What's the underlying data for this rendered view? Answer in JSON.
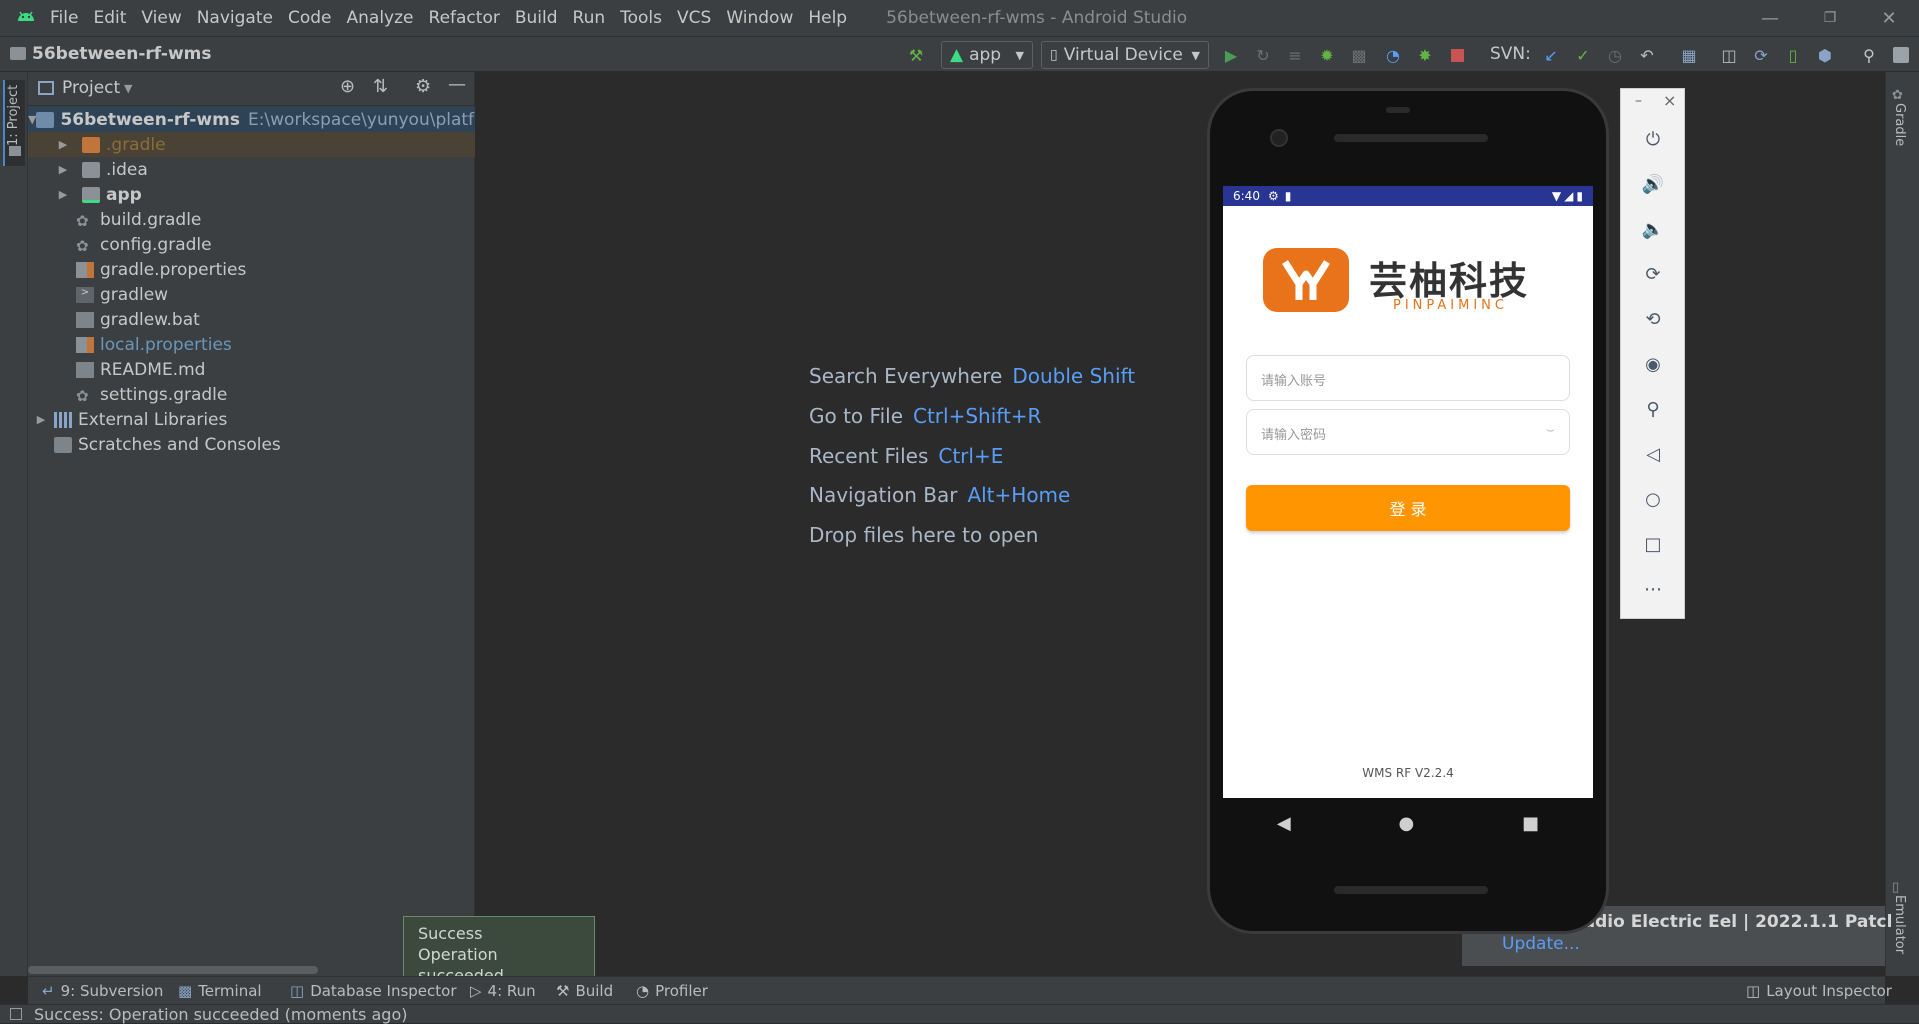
{
  "window": {
    "title": "56between-rf-wms - Android Studio",
    "controls": {
      "minimize": "—",
      "restore": "❐",
      "close": "✕"
    }
  },
  "menu": [
    "File",
    "Edit",
    "View",
    "Navigate",
    "Code",
    "Analyze",
    "Refactor",
    "Build",
    "Run",
    "Tools",
    "VCS",
    "Window",
    "Help"
  ],
  "navbar": {
    "breadcrumb": "56between-rf-wms",
    "run_config": "app",
    "device": "Virtual Device",
    "svn_label": "SVN:"
  },
  "left_stripe": {
    "project_tab": "1: Project"
  },
  "right_stripe": {
    "gradle_tab": "Gradle",
    "emulator_tab": "Emulator"
  },
  "project_panel": {
    "header": "Project",
    "tree": [
      {
        "name": "56between-rf-wms",
        "path": "E:\\workspace\\yunyou\\platform",
        "level": 0,
        "expanded": true,
        "kind": "module",
        "bold": true
      },
      {
        "name": ".gradle",
        "level": 1,
        "expanded": false,
        "kind": "folder-orange",
        "dim": true,
        "selected": true
      },
      {
        "name": ".idea",
        "level": 1,
        "expanded": false,
        "kind": "folder"
      },
      {
        "name": "app",
        "level": 1,
        "expanded": false,
        "kind": "folder-module",
        "bold": true
      },
      {
        "name": "build.gradle",
        "level": 1,
        "kind": "gradle"
      },
      {
        "name": "config.gradle",
        "level": 1,
        "kind": "gradle"
      },
      {
        "name": "gradle.properties",
        "level": 1,
        "kind": "properties"
      },
      {
        "name": "gradlew",
        "level": 1,
        "kind": "script"
      },
      {
        "name": "gradlew.bat",
        "level": 1,
        "kind": "file"
      },
      {
        "name": "local.properties",
        "level": 1,
        "kind": "properties",
        "link": true
      },
      {
        "name": "README.md",
        "level": 1,
        "kind": "file"
      },
      {
        "name": "settings.gradle",
        "level": 1,
        "kind": "gradle"
      },
      {
        "name": "External Libraries",
        "level": 0,
        "expanded": false,
        "kind": "library"
      },
      {
        "name": "Scratches and Consoles",
        "level": 0,
        "kind": "scratch"
      }
    ]
  },
  "editor_hints": [
    {
      "label": "Search Everywhere",
      "key": "Double Shift"
    },
    {
      "label": "Go to File",
      "key": "Ctrl+Shift+R"
    },
    {
      "label": "Recent Files",
      "key": "Ctrl+E"
    },
    {
      "label": "Navigation Bar",
      "key": "Alt+Home"
    },
    {
      "label": "Drop files here to open",
      "key": ""
    }
  ],
  "emulator": {
    "status_time": "6:40",
    "app": {
      "brand_cn": "芸柚科技",
      "brand_en": "PINPAIMINC",
      "account_placeholder": "请输入账号",
      "password_placeholder": "请输入密码",
      "login_button": "登 录",
      "version": "WMS RF V2.2.4"
    },
    "side_close": "×",
    "side_min": "–"
  },
  "notification": {
    "title": "udio Electric Eel | 2022.1.1 Patcl",
    "link": "Update..."
  },
  "balloon": {
    "title": "Success",
    "message": "Operation succeeded"
  },
  "bottom_tabs": [
    {
      "label": "9: Subversion"
    },
    {
      "label": "Terminal"
    },
    {
      "label": "Database Inspector"
    },
    {
      "label": "4: Run"
    },
    {
      "label": "Build"
    },
    {
      "label": "Profiler"
    }
  ],
  "bottom_right_tab": "Layout Inspector",
  "status_line": "Success: Operation succeeded (moments ago)",
  "colors": {
    "accent": "#589df6",
    "login_orange": "#ff9500",
    "statusbar": "#283593",
    "brand_orange": "#e8731a"
  }
}
